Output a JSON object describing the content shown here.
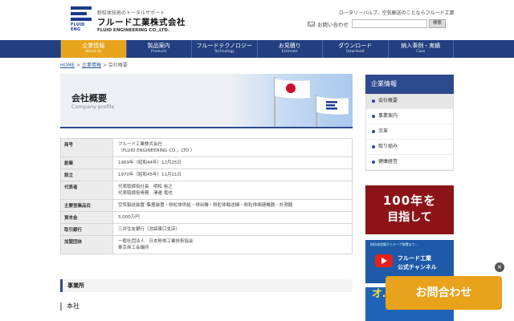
{
  "header": {
    "tagline": "粉粒体技術のトータルサポート",
    "company_name": "フルード工業株式会社",
    "company_en": "FLUID ENGINEERING CO.,LTD.",
    "logo_caption": "FLUID ENG",
    "right_text": "ロータリーバルブ、空気輸送のことならフルード工業",
    "contact_label": "お問い合わせ",
    "search_placeholder": "",
    "search_button": "検索"
  },
  "nav": [
    {
      "jp": "企業情報",
      "en": "About Us",
      "active": true
    },
    {
      "jp": "製品案内",
      "en": "Products"
    },
    {
      "jp": "フルードテクノロジー",
      "en": "Technology"
    },
    {
      "jp": "お見積り",
      "en": "Estimate"
    },
    {
      "jp": "ダウンロード",
      "en": "Download"
    },
    {
      "jp": "納入事例・実績",
      "en": "Case"
    }
  ],
  "breadcrumb": {
    "home": "HOME",
    "sep": " > ",
    "parent": "企業情報",
    "current": "会社概要"
  },
  "banner": {
    "title": "会社概要",
    "subtitle": "Company profile"
  },
  "table": [
    {
      "label": "商号",
      "lines": [
        "フルード工業株式会社",
        "（FLUID ENGINEERING CO.，LTD.）"
      ]
    },
    {
      "label": "創業",
      "lines": [
        "1969年（昭和44年）12月25日"
      ]
    },
    {
      "label": "設立",
      "lines": [
        "1970年（昭和45年）11月11日"
      ]
    },
    {
      "label": "代表者",
      "lines": [
        "代表取締役社長　明松 裕之",
        "代表取締役専務　澤邉 竜也"
      ]
    },
    {
      "label": "主要営業品目",
      "lines": [
        "空気輸送装置･集塵装置・粉粒体供給・排出機・粉粒体輸送機・粉粒体関連機器・計測器"
      ]
    },
    {
      "label": "資本金",
      "lines": [
        "5,000万円"
      ]
    },
    {
      "label": "取引銀行",
      "lines": [
        "三井住友銀行（池袋東口支店）"
      ]
    },
    {
      "label": "加盟団体",
      "lines": [
        "一般社団法人　日本粉体工業技術協会",
        "東京商工会議所"
      ]
    }
  ],
  "section": {
    "title": "事業所",
    "sub": "本社"
  },
  "sidebar": {
    "heading": "企業情報",
    "items": [
      "会社概要",
      "事業案内",
      "沿革",
      "取り組み",
      "健康経営"
    ]
  },
  "promo1": {
    "line1": "100年を",
    "line2": "目指して"
  },
  "promo2": {
    "small": "粉粒体設備からテープ装置まで…",
    "line1": "フルード工業",
    "line2": "公式チャンネル"
  },
  "promo3": {
    "text": "オ…"
  },
  "floating": {
    "contact": "お問合わせ",
    "close": "×"
  }
}
